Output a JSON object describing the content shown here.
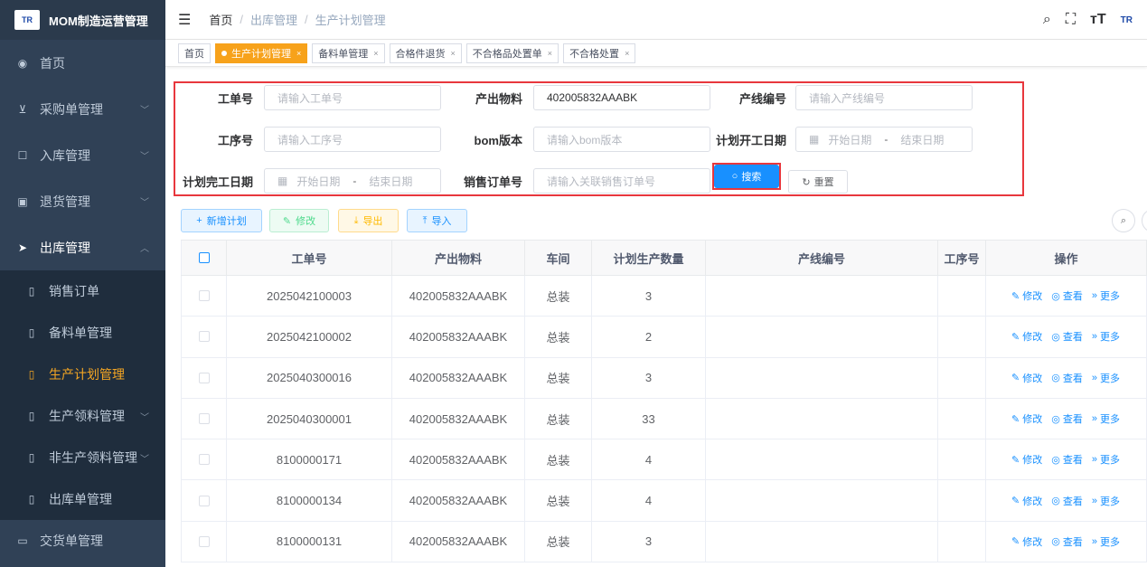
{
  "brand": {
    "logo": "TR",
    "title": "MOM制造运营管理"
  },
  "sidebar": {
    "items": [
      {
        "label": "首页",
        "icon": "dashboard-icon"
      },
      {
        "label": "采购单管理",
        "icon": "cart-icon"
      },
      {
        "label": "入库管理",
        "icon": "edit-icon"
      },
      {
        "label": "退货管理",
        "icon": "return-icon"
      },
      {
        "label": "出库管理",
        "icon": "send-icon"
      }
    ],
    "subitems": [
      {
        "label": "销售订单"
      },
      {
        "label": "备料单管理"
      },
      {
        "label": "生产计划管理"
      },
      {
        "label": "生产领料管理"
      },
      {
        "label": "非生产领料管理"
      },
      {
        "label": "出库单管理"
      },
      {
        "label": "交货单管理"
      }
    ]
  },
  "header": {
    "crumbs": [
      "首页",
      "出库管理",
      "生产计划管理"
    ],
    "logo": "TR"
  },
  "tags": [
    "首页",
    "生产计划管理",
    "备料单管理",
    "合格件退货",
    "不合格品处置单",
    "不合格处置"
  ],
  "form": {
    "work_order": {
      "label": "工单号",
      "placeholder": "请输入工单号"
    },
    "material": {
      "label": "产出物料",
      "value": "402005832AAABK"
    },
    "line": {
      "label": "产线编号",
      "placeholder": "请输入产线编号"
    },
    "process": {
      "label": "工序号",
      "placeholder": "请输入工序号"
    },
    "bom": {
      "label": "bom版本",
      "placeholder": "请输入bom版本"
    },
    "plan_start": {
      "label": "计划开工日期",
      "start": "开始日期",
      "sep": "-",
      "end": "结束日期"
    },
    "plan_end": {
      "label": "计划完工日期",
      "start": "开始日期",
      "sep": "-",
      "end": "结束日期"
    },
    "sales_order": {
      "label": "销售订单号",
      "placeholder": "请输入关联销售订单号"
    },
    "search": "搜索",
    "reset": "重置"
  },
  "actions": {
    "add": "新增计划",
    "edit": "修改",
    "export": "导出",
    "import": "导入"
  },
  "table": {
    "columns": [
      "工单号",
      "产出物料",
      "车间",
      "计划生产数量",
      "产线编号",
      "工序号",
      "操作"
    ],
    "rows": [
      {
        "order": "2025042100003",
        "material": "402005832AAABK",
        "shop": "总装",
        "qty": "3"
      },
      {
        "order": "2025042100002",
        "material": "402005832AAABK",
        "shop": "总装",
        "qty": "2"
      },
      {
        "order": "2025040300016",
        "material": "402005832AAABK",
        "shop": "总装",
        "qty": "3"
      },
      {
        "order": "2025040300001",
        "material": "402005832AAABK",
        "shop": "总装",
        "qty": "33"
      },
      {
        "order": "8100000171",
        "material": "402005832AAABK",
        "shop": "总装",
        "qty": "4"
      },
      {
        "order": "8100000134",
        "material": "402005832AAABK",
        "shop": "总装",
        "qty": "4"
      },
      {
        "order": "8100000131",
        "material": "402005832AAABK",
        "shop": "总装",
        "qty": "3"
      }
    ],
    "op_edit": "修改",
    "op_view": "查看",
    "op_more": "更多"
  }
}
